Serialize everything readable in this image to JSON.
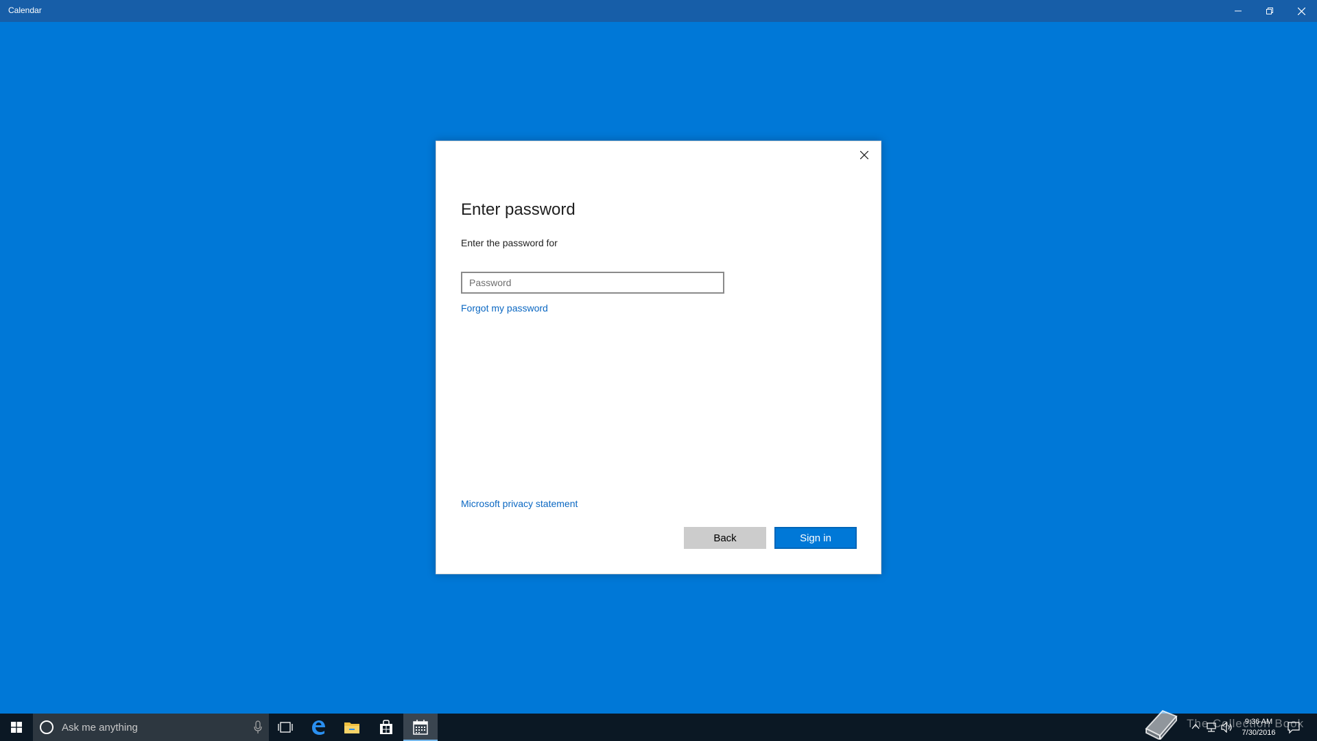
{
  "window": {
    "title": "Calendar"
  },
  "dialog": {
    "title": "Enter password",
    "subtitle": "Enter the password for",
    "password_placeholder": "Password",
    "forgot_link": "Forgot my password",
    "privacy_link": "Microsoft privacy statement",
    "back_label": "Back",
    "signin_label": "Sign in"
  },
  "taskbar": {
    "search_placeholder": "Ask me anything",
    "watermark": "The Collection Book",
    "time": "9:36 AM",
    "date": "7/30/2016"
  },
  "colors": {
    "accent": "#0078d7",
    "titlebar": "#175ea8",
    "taskbar": "#0b1824",
    "link": "#0a67c2"
  },
  "icons": {
    "start": "windows-logo-icon",
    "cortana": "cortana-circle-icon",
    "mic": "microphone-icon",
    "taskview": "task-view-icon",
    "edge": "edge-icon",
    "explorer": "folder-icon",
    "store": "store-icon",
    "calendar": "calendar-icon"
  }
}
